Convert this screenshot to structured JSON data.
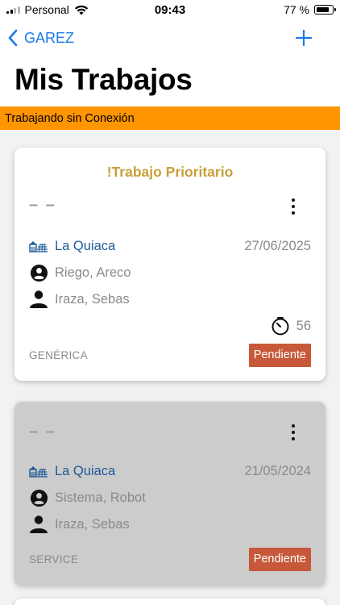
{
  "status_bar": {
    "carrier": "Personal",
    "time": "09:43",
    "battery_percent": "77 %",
    "battery_level": 0.77
  },
  "nav": {
    "back_label": "GAREZ",
    "add_icon": "plus-icon",
    "title": "Mis Trabajos"
  },
  "banner": {
    "text": "Trabajando sin Conexión",
    "color": "#ff9500"
  },
  "colors": {
    "accent": "#1a7ae8",
    "priority": "#c8a03a",
    "badge": "#c8583a",
    "location": "#1e5a96"
  },
  "jobs": [
    {
      "priority_label": "!Trabajo Prioritario",
      "code": "– –",
      "location": "La Quiaca",
      "date": "27/06/2025",
      "client": "Riego, Areco",
      "assignee": "Iraza, Sebas",
      "timer_value": "56",
      "type": "GENÉRICA",
      "status": "Pendiente"
    },
    {
      "priority_label": "",
      "code": "– –",
      "location": "La Quiaca",
      "date": "21/05/2024",
      "client": "Sistema, Robot",
      "assignee": "Iraza, Sebas",
      "timer_value": "",
      "type": "SERVICE",
      "status": "Pendiente"
    }
  ]
}
